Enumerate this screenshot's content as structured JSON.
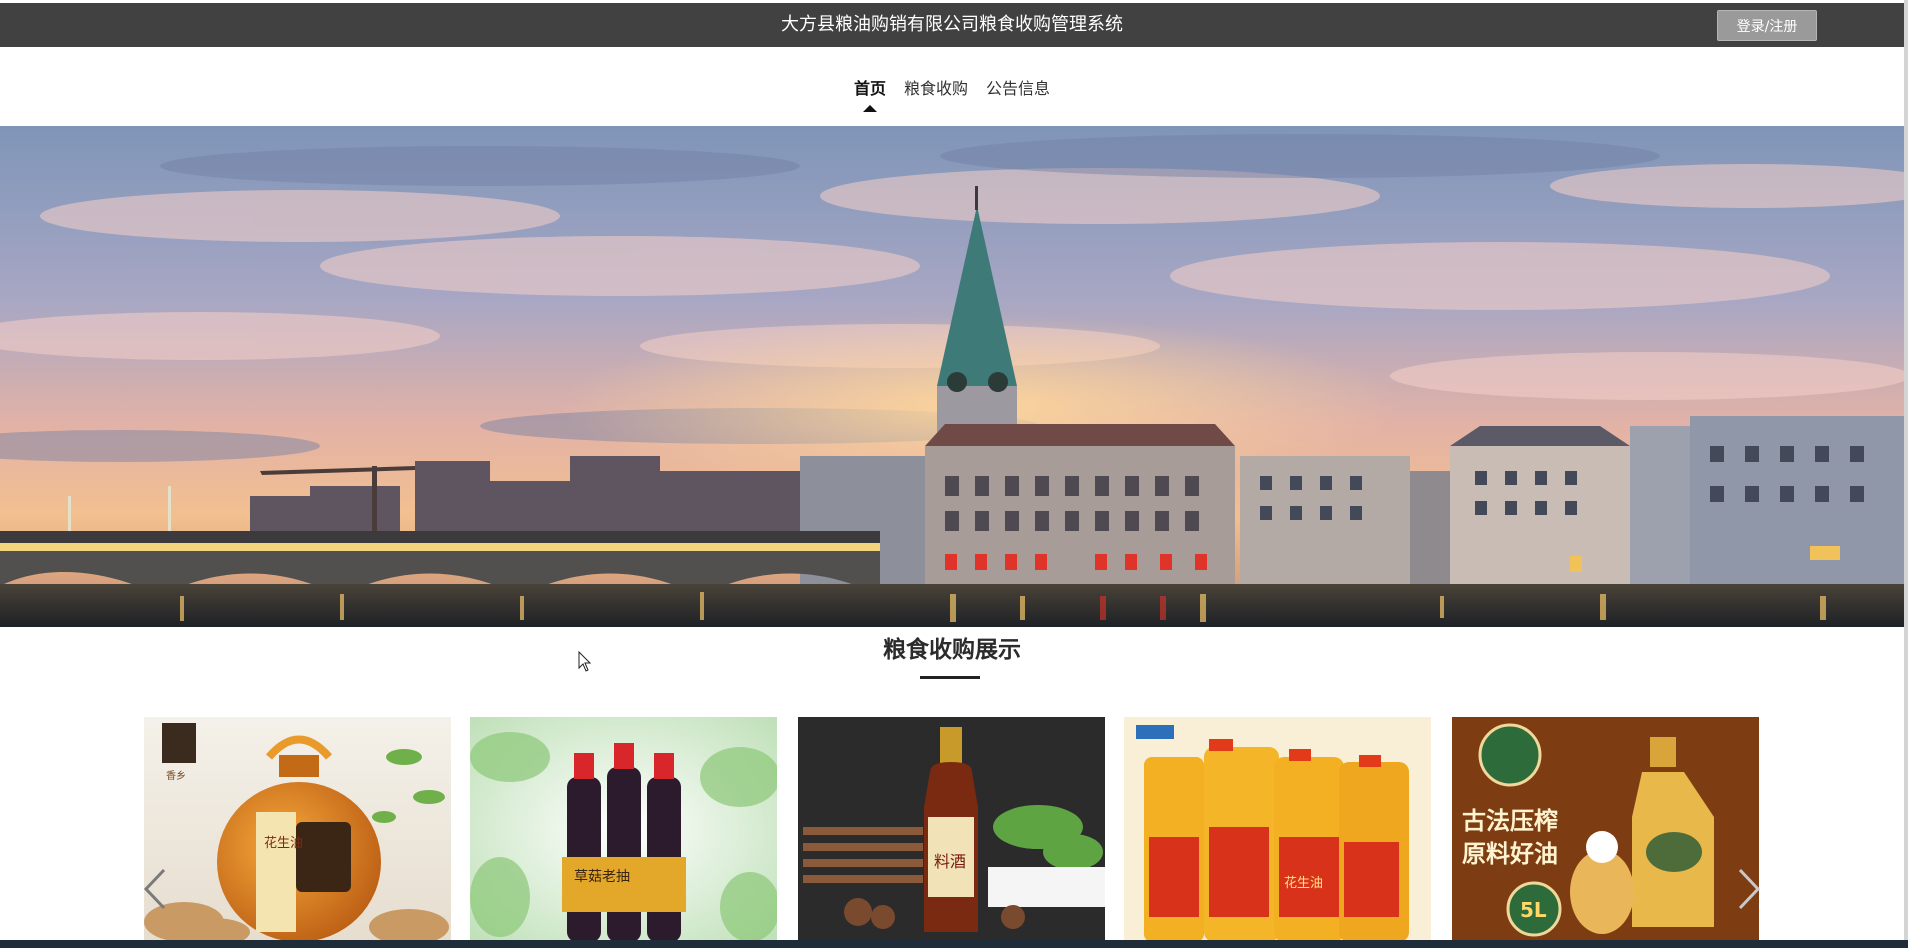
{
  "header": {
    "title": "大方县粮油购销有限公司粮食收购管理系统",
    "login_label": "登录/注册",
    "background": "#414141"
  },
  "nav": {
    "items": [
      {
        "label": "首页",
        "active": true
      },
      {
        "label": "粮食收购",
        "active": false
      },
      {
        "label": "公告信息",
        "active": false
      }
    ]
  },
  "banner": {
    "icon": "city-skyline-image"
  },
  "showcase": {
    "title": "粮食收购展示",
    "products": [
      {
        "icon": "peanut-oil-jar-image",
        "label_a": "香乡",
        "label_b": "花生油"
      },
      {
        "icon": "soy-sauce-bottles-image",
        "label_a": "草菇老抽"
      },
      {
        "icon": "cooking-wine-bottle-image",
        "label_a": "料酒"
      },
      {
        "icon": "peanut-oil-drums-image",
        "label_a": "花生油"
      },
      {
        "icon": "pressed-oil-ad-image",
        "label_a": "古法压榨",
        "label_b": "原料好油",
        "label_c": "5L"
      }
    ],
    "prev_icon": "chevron-left-icon",
    "next_icon": "chevron-right-icon"
  }
}
